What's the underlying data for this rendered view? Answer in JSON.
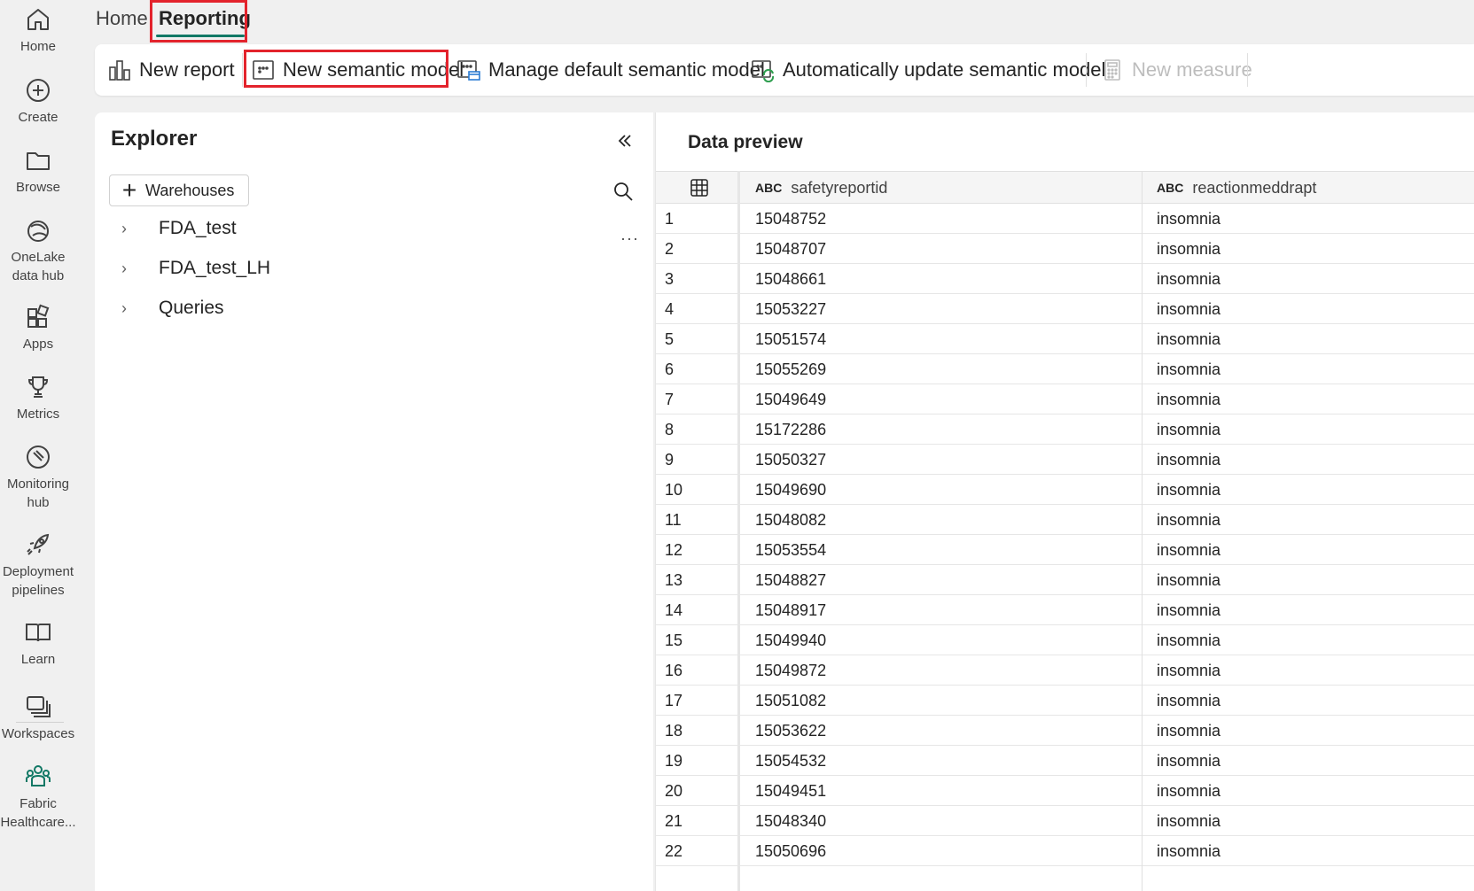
{
  "rail": {
    "items": [
      {
        "label": "Home",
        "icon": "home-icon"
      },
      {
        "label": "Create",
        "icon": "create-icon"
      },
      {
        "label": "Browse",
        "icon": "folder-icon"
      },
      {
        "label": "OneLake data hub",
        "icon": "onelake-icon"
      },
      {
        "label": "Apps",
        "icon": "apps-icon"
      },
      {
        "label": "Metrics",
        "icon": "trophy-icon"
      },
      {
        "label": "Monitoring hub",
        "icon": "monitoring-icon"
      },
      {
        "label": "Deployment pipelines",
        "icon": "rocket-icon"
      },
      {
        "label": "Learn",
        "icon": "book-icon"
      },
      {
        "label": "Workspaces",
        "icon": "workspaces-icon"
      },
      {
        "label": "Fabric Healthcare...",
        "icon": "healthcare-icon"
      }
    ]
  },
  "tabs": {
    "home": "Home",
    "reporting": "Reporting"
  },
  "ribbon": {
    "new_report": "New report",
    "new_semantic_model": "New semantic model",
    "manage_default_semantic_model": "Manage default semantic model",
    "auto_update_semantic_model": "Automatically update semantic model",
    "new_measure": "New measure"
  },
  "explorer": {
    "title": "Explorer",
    "warehouses_button": "Warehouses",
    "more": "···",
    "items": [
      "FDA_test",
      "FDA_test_LH",
      "Queries"
    ]
  },
  "preview": {
    "title": "Data preview",
    "type_badge": "ABC",
    "columns": [
      "safetyreportid",
      "reactionmeddrapt"
    ],
    "rows": [
      [
        "1",
        "15048752",
        "insomnia"
      ],
      [
        "2",
        "15048707",
        "insomnia"
      ],
      [
        "3",
        "15048661",
        "insomnia"
      ],
      [
        "4",
        "15053227",
        "insomnia"
      ],
      [
        "5",
        "15051574",
        "insomnia"
      ],
      [
        "6",
        "15055269",
        "insomnia"
      ],
      [
        "7",
        "15049649",
        "insomnia"
      ],
      [
        "8",
        "15172286",
        "insomnia"
      ],
      [
        "9",
        "15050327",
        "insomnia"
      ],
      [
        "10",
        "15049690",
        "insomnia"
      ],
      [
        "11",
        "15048082",
        "insomnia"
      ],
      [
        "12",
        "15053554",
        "insomnia"
      ],
      [
        "13",
        "15048827",
        "insomnia"
      ],
      [
        "14",
        "15048917",
        "insomnia"
      ],
      [
        "15",
        "15049940",
        "insomnia"
      ],
      [
        "16",
        "15049872",
        "insomnia"
      ],
      [
        "17",
        "15051082",
        "insomnia"
      ],
      [
        "18",
        "15053622",
        "insomnia"
      ],
      [
        "19",
        "15054532",
        "insomnia"
      ],
      [
        "20",
        "15049451",
        "insomnia"
      ],
      [
        "21",
        "15048340",
        "insomnia"
      ],
      [
        "22",
        "15050696",
        "insomnia"
      ]
    ]
  },
  "colors": {
    "accent": "#117865",
    "highlight": "#e3232c"
  }
}
